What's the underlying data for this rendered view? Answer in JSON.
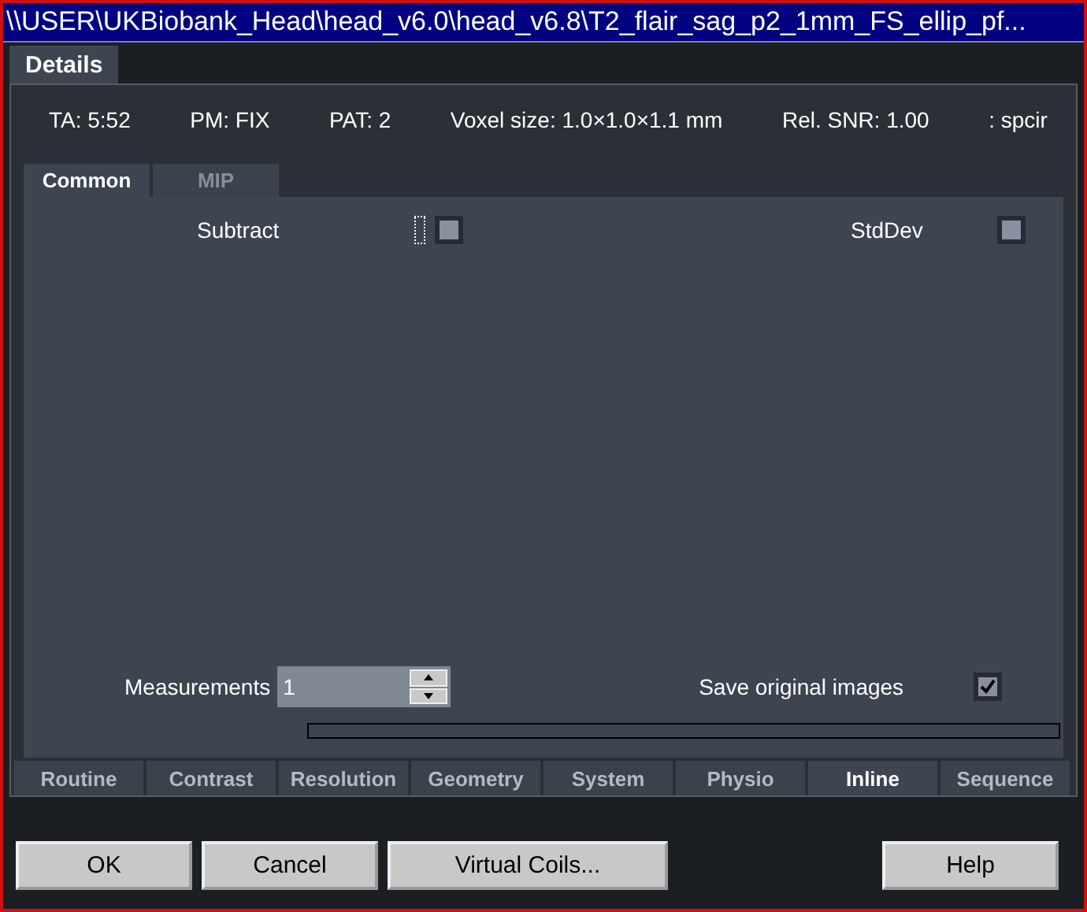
{
  "window": {
    "title": "\\\\USER\\UKBiobank_Head\\head_v6.0\\head_v6.8\\T2_flair_sag_p2_1mm_FS_ellip_pf..."
  },
  "top_tabs": [
    {
      "label": "Details",
      "selected": true
    }
  ],
  "info": [
    "TA: 5:52",
    "PM: FIX",
    "PAT: 2",
    "Voxel size: 1.0×1.0×1.1 mm",
    "Rel. SNR: 1.00",
    ": spcir"
  ],
  "sub_tabs": [
    {
      "label": "Common",
      "selected": true
    },
    {
      "label": "MIP",
      "selected": false
    }
  ],
  "options": [
    {
      "label": "Subtract",
      "checked": false,
      "focused": true
    },
    {
      "label": "StdDev",
      "checked": false,
      "focused": false
    }
  ],
  "measurements": {
    "label": "Measurements",
    "value": "1"
  },
  "save_original": {
    "label": "Save original images",
    "checked": true
  },
  "tabs": [
    {
      "label": "Routine",
      "selected": false
    },
    {
      "label": "Contrast",
      "selected": false
    },
    {
      "label": "Resolution",
      "selected": false
    },
    {
      "label": "Geometry",
      "selected": false
    },
    {
      "label": "System",
      "selected": false
    },
    {
      "label": "Physio",
      "selected": false
    },
    {
      "label": "Inline",
      "selected": true
    },
    {
      "label": "Sequence",
      "selected": false
    }
  ],
  "progress": {
    "level": 0
  },
  "buttons": [
    {
      "label": "OK"
    },
    {
      "label": "Cancel"
    },
    {
      "label": "Virtual Coils..."
    },
    {
      "label": "Help"
    }
  ]
}
